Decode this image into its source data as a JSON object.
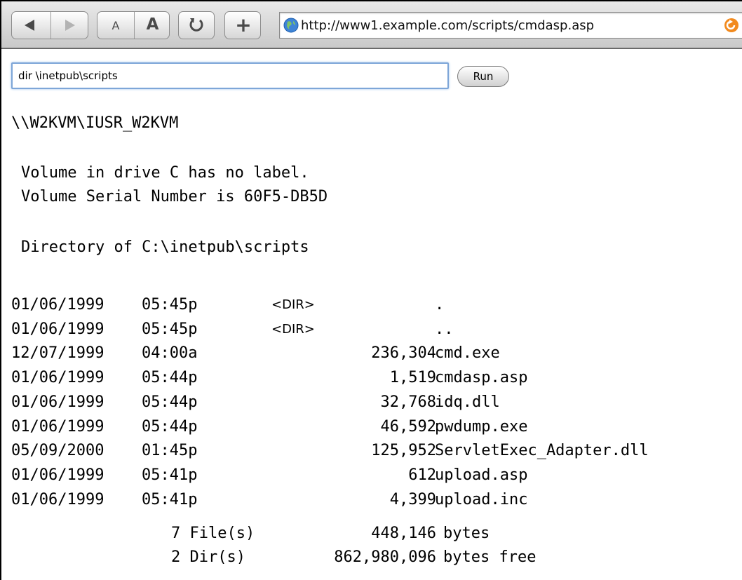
{
  "browser": {
    "back_icon": "back-arrow-icon",
    "forward_icon": "forward-arrow-icon",
    "text_smaller_label": "A",
    "text_bigger_label": "A",
    "reload_icon": "reload-icon",
    "add_bookmark_label": "+",
    "url": "http://www1.example.com/scripts/cmdasp.asp",
    "site_icon": "globe-icon",
    "snapback_icon": "snapback-icon"
  },
  "form": {
    "command_value": "dir \\inetpub\\scripts",
    "run_label": "Run"
  },
  "output": {
    "user": "\\\\W2KVM\\IUSR_W2KVM",
    "volume_label_line": "Volume in drive C has no label.",
    "serial_line": "Volume Serial Number is 60F5-DB5D",
    "directory_line": "Directory of C:\\inetpub\\scripts",
    "entries": [
      {
        "date": "01/06/1999",
        "time": "05:45p",
        "dir": "<DIR>",
        "size": "",
        "name": "."
      },
      {
        "date": "01/06/1999",
        "time": "05:45p",
        "dir": "<DIR>",
        "size": "",
        "name": ".."
      },
      {
        "date": "12/07/1999",
        "time": "04:00a",
        "dir": "",
        "size": "236,304",
        "name": "cmd.exe"
      },
      {
        "date": "01/06/1999",
        "time": "05:44p",
        "dir": "",
        "size": "1,519",
        "name": "cmdasp.asp"
      },
      {
        "date": "01/06/1999",
        "time": "05:44p",
        "dir": "",
        "size": "32,768",
        "name": "idq.dll"
      },
      {
        "date": "01/06/1999",
        "time": "05:44p",
        "dir": "",
        "size": "46,592",
        "name": "pwdump.exe"
      },
      {
        "date": "05/09/2000",
        "time": "01:45p",
        "dir": "",
        "size": "125,952",
        "name": "ServletExec_Adapter.dll"
      },
      {
        "date": "01/06/1999",
        "time": "05:41p",
        "dir": "",
        "size": "612",
        "name": "upload.asp"
      },
      {
        "date": "01/06/1999",
        "time": "05:41p",
        "dir": "",
        "size": "4,399",
        "name": "upload.inc"
      }
    ],
    "files_summary": {
      "count": "7 File(s)",
      "size": "448,146",
      "unit": "bytes"
    },
    "dirs_summary": {
      "count": "2 Dir(s)",
      "size": "862,980,096",
      "unit": "bytes free"
    }
  }
}
